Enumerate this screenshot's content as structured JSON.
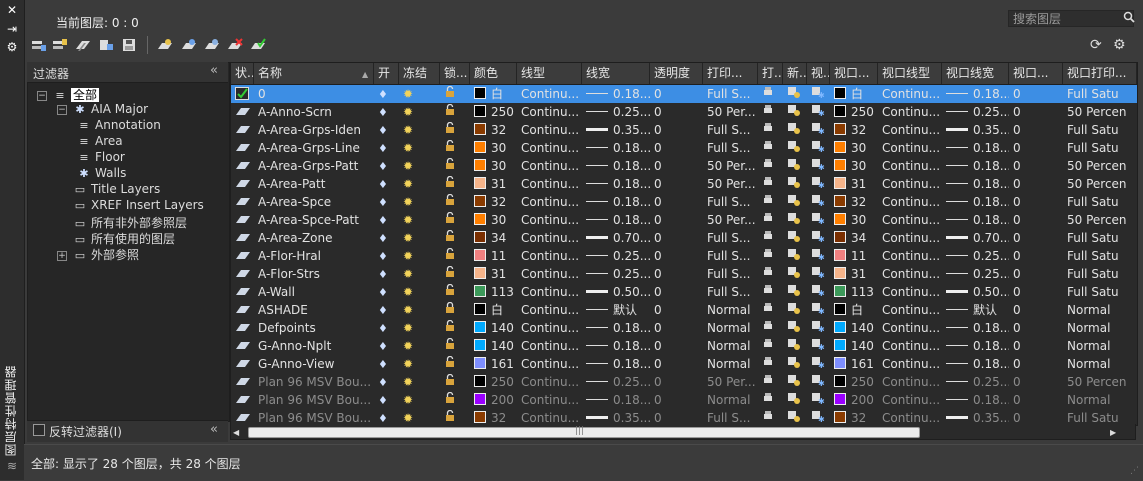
{
  "window": {
    "side_title": "图层特性管理器",
    "close_glyph": "✕",
    "pin_glyph": "⇥",
    "prop_glyph": "⚙"
  },
  "toolbar": {
    "current_layer": "当前图层: 0 : 0",
    "search_placeholder": "搜索图层",
    "buttons": [
      "new-property-filter-icon",
      "new-group-filter-icon",
      "layer-states-manager-icon",
      "properties-icon",
      "save-icon",
      "new-layer-icon",
      "new-layer-vp-frozen-icon",
      "new-layer-vp-all-icon",
      "delete-layer-icon",
      "set-current-icon"
    ],
    "refresh_glyph": "⟳",
    "settings_glyph": "⚙"
  },
  "filter_panel": {
    "title": "过滤器",
    "collapse_glyph": "«",
    "tree": [
      {
        "label": "全部",
        "expander": "−",
        "icon": "layers-icon",
        "level": 0
      },
      {
        "label": "AIA Major",
        "expander": "−",
        "icon": "group-filter-icon",
        "level": 1
      },
      {
        "label": "Annotation",
        "expander": "",
        "icon": "property-filter-icon",
        "level": 2
      },
      {
        "label": "Area",
        "expander": "",
        "icon": "property-filter-icon",
        "level": 2
      },
      {
        "label": "Floor",
        "expander": "",
        "icon": "property-filter-icon",
        "level": 2
      },
      {
        "label": "Walls",
        "expander": "",
        "icon": "group-filter-icon",
        "level": 2
      },
      {
        "label": "Title Layers",
        "expander": "",
        "icon": "xref-filter-icon",
        "level": 1
      },
      {
        "label": "XREF Insert Layers",
        "expander": "",
        "icon": "xref-filter-icon",
        "level": 1
      },
      {
        "label": "所有非外部参照层",
        "expander": "",
        "icon": "xref-filter-icon",
        "level": 1
      },
      {
        "label": "所有使用的图层",
        "expander": "",
        "icon": "xref-filter-icon",
        "level": 1
      },
      {
        "label": "外部参照",
        "expander": "+",
        "icon": "xref-folder-icon",
        "level": 1
      }
    ],
    "invert_label": "反转过滤器(I)"
  },
  "grid": {
    "columns": [
      "状...",
      "名称",
      "开",
      "冻结",
      "锁...",
      "颜色",
      "线型",
      "线宽",
      "透明度",
      "打印...",
      "打...",
      "新...",
      "视...",
      "视口...",
      "视口线型",
      "视口线宽",
      "视口...",
      "视口打印..."
    ],
    "rows": [
      {
        "name": "0",
        "color": "#000000",
        "color_label": "白",
        "linetype": "Continu...",
        "lineweight": "0.18...",
        "lw_thick": false,
        "transparency": "0",
        "plot_style": "Full S...",
        "vp_color": "#000000",
        "vp_color_label": "白",
        "vp_linetype": "Continu...",
        "vp_lineweight": "0.18...",
        "vp_transparency": "0",
        "vp_plot_style": "Full Satu",
        "selected": true,
        "dim": false,
        "locked": false
      },
      {
        "name": "A-Anno-Scrn",
        "color": "#000000",
        "color_label": "250",
        "linetype": "Continu...",
        "lineweight": "0.25...",
        "lw_thick": false,
        "transparency": "0",
        "plot_style": "50 Per...",
        "vp_color": "#000000",
        "vp_color_label": "250",
        "vp_linetype": "Continu...",
        "vp_lineweight": "0.25...",
        "vp_transparency": "0",
        "vp_plot_style": "50 Percen",
        "selected": false,
        "dim": false,
        "locked": false
      },
      {
        "name": "A-Area-Grps-Iden",
        "color": "#8a3b00",
        "color_label": "32",
        "linetype": "Continu...",
        "lineweight": "0.35...",
        "lw_thick": true,
        "transparency": "0",
        "plot_style": "Full S...",
        "vp_color": "#8a3b00",
        "vp_color_label": "32",
        "vp_linetype": "Continu...",
        "vp_lineweight": "0.35...",
        "vp_transparency": "0",
        "vp_plot_style": "Full Satu",
        "selected": false,
        "dim": false,
        "locked": false
      },
      {
        "name": "A-Area-Grps-Line",
        "color": "#ff7f00",
        "color_label": "30",
        "linetype": "Continu...",
        "lineweight": "0.18...",
        "lw_thick": false,
        "transparency": "0",
        "plot_style": "Full S...",
        "vp_color": "#ff7f00",
        "vp_color_label": "30",
        "vp_linetype": "Continu...",
        "vp_lineweight": "0.18...",
        "vp_transparency": "0",
        "vp_plot_style": "Full Satu",
        "selected": false,
        "dim": false,
        "locked": false
      },
      {
        "name": "A-Area-Grps-Patt",
        "color": "#ff7f00",
        "color_label": "30",
        "linetype": "Continu...",
        "lineweight": "0.18...",
        "lw_thick": false,
        "transparency": "0",
        "plot_style": "50 Per...",
        "vp_color": "#ff7f00",
        "vp_color_label": "30",
        "vp_linetype": "Continu...",
        "vp_lineweight": "0.18...",
        "vp_transparency": "0",
        "vp_plot_style": "50 Percen",
        "selected": false,
        "dim": false,
        "locked": false
      },
      {
        "name": "A-Area-Patt",
        "color": "#f5b48a",
        "color_label": "31",
        "linetype": "Continu...",
        "lineweight": "0.18...",
        "lw_thick": false,
        "transparency": "0",
        "plot_style": "50 Per...",
        "vp_color": "#f5b48a",
        "vp_color_label": "31",
        "vp_linetype": "Continu...",
        "vp_lineweight": "0.18...",
        "vp_transparency": "0",
        "vp_plot_style": "50 Percen",
        "selected": false,
        "dim": false,
        "locked": false
      },
      {
        "name": "A-Area-Spce",
        "color": "#8a3b00",
        "color_label": "32",
        "linetype": "Continu...",
        "lineweight": "0.18...",
        "lw_thick": false,
        "transparency": "0",
        "plot_style": "Full S...",
        "vp_color": "#8a3b00",
        "vp_color_label": "32",
        "vp_linetype": "Continu...",
        "vp_lineweight": "0.18...",
        "vp_transparency": "0",
        "vp_plot_style": "Full Satu",
        "selected": false,
        "dim": false,
        "locked": false
      },
      {
        "name": "A-Area-Spce-Patt",
        "color": "#ff7f00",
        "color_label": "30",
        "linetype": "Continu...",
        "lineweight": "0.18...",
        "lw_thick": false,
        "transparency": "0",
        "plot_style": "50 Per...",
        "vp_color": "#ff7f00",
        "vp_color_label": "30",
        "vp_linetype": "Continu...",
        "vp_lineweight": "0.18...",
        "vp_transparency": "0",
        "vp_plot_style": "50 Percen",
        "selected": false,
        "dim": false,
        "locked": false
      },
      {
        "name": "A-Area-Zone",
        "color": "#7a2e00",
        "color_label": "34",
        "linetype": "Continu...",
        "lineweight": "0.70...",
        "lw_thick": true,
        "transparency": "0",
        "plot_style": "Full S...",
        "vp_color": "#7a2e00",
        "vp_color_label": "34",
        "vp_linetype": "Continu...",
        "vp_lineweight": "0.70...",
        "vp_transparency": "0",
        "vp_plot_style": "Full Satu",
        "selected": false,
        "dim": false,
        "locked": false
      },
      {
        "name": "A-Flor-Hral",
        "color": "#f08080",
        "color_label": "11",
        "linetype": "Continu...",
        "lineweight": "0.25...",
        "lw_thick": false,
        "transparency": "0",
        "plot_style": "Full S...",
        "vp_color": "#f08080",
        "vp_color_label": "11",
        "vp_linetype": "Continu...",
        "vp_lineweight": "0.25...",
        "vp_transparency": "0",
        "vp_plot_style": "Full Satu",
        "selected": false,
        "dim": false,
        "locked": false
      },
      {
        "name": "A-Flor-Strs",
        "color": "#f5b48a",
        "color_label": "31",
        "linetype": "Continu...",
        "lineweight": "0.25...",
        "lw_thick": false,
        "transparency": "0",
        "plot_style": "Full S...",
        "vp_color": "#f5b48a",
        "vp_color_label": "31",
        "vp_linetype": "Continu...",
        "vp_lineweight": "0.25...",
        "vp_transparency": "0",
        "vp_plot_style": "Full Satu",
        "selected": false,
        "dim": false,
        "locked": false
      },
      {
        "name": "A-Wall",
        "color": "#3c9a5a",
        "color_label": "113",
        "linetype": "Continu...",
        "lineweight": "0.50...",
        "lw_thick": true,
        "transparency": "0",
        "plot_style": "Full S...",
        "vp_color": "#3c9a5a",
        "vp_color_label": "113",
        "vp_linetype": "Continu...",
        "vp_lineweight": "0.50...",
        "vp_transparency": "0",
        "vp_plot_style": "Full Satu",
        "selected": false,
        "dim": false,
        "locked": false
      },
      {
        "name": "ASHADE",
        "color": "#000000",
        "color_label": "白",
        "linetype": "Continu...",
        "lineweight": "默认",
        "lw_thick": false,
        "transparency": "0",
        "plot_style": "Normal",
        "vp_color": "#000000",
        "vp_color_label": "白",
        "vp_linetype": "Continu...",
        "vp_lineweight": "默认",
        "vp_transparency": "0",
        "vp_plot_style": "Normal",
        "selected": false,
        "dim": false,
        "locked": true
      },
      {
        "name": "Defpoints",
        "color": "#00aaff",
        "color_label": "140",
        "linetype": "Continu...",
        "lineweight": "0.18...",
        "lw_thick": false,
        "transparency": "0",
        "plot_style": "Normal",
        "vp_color": "#00aaff",
        "vp_color_label": "140",
        "vp_linetype": "Continu...",
        "vp_lineweight": "0.18...",
        "vp_transparency": "0",
        "vp_plot_style": "Normal",
        "selected": false,
        "dim": false,
        "locked": false
      },
      {
        "name": "G-Anno-Nplt",
        "color": "#00aaff",
        "color_label": "140",
        "linetype": "Continu...",
        "lineweight": "0.18...",
        "lw_thick": false,
        "transparency": "0",
        "plot_style": "Normal",
        "vp_color": "#00aaff",
        "vp_color_label": "140",
        "vp_linetype": "Continu...",
        "vp_lineweight": "0.18...",
        "vp_transparency": "0",
        "vp_plot_style": "Normal",
        "selected": false,
        "dim": false,
        "locked": false
      },
      {
        "name": "G-Anno-View",
        "color": "#7f8fff",
        "color_label": "161",
        "linetype": "Continu...",
        "lineweight": "0.18...",
        "lw_thick": false,
        "transparency": "0",
        "plot_style": "Normal",
        "vp_color": "#7f8fff",
        "vp_color_label": "161",
        "vp_linetype": "Continu...",
        "vp_lineweight": "0.18...",
        "vp_transparency": "0",
        "vp_plot_style": "Normal",
        "selected": false,
        "dim": false,
        "locked": false
      },
      {
        "name": "Plan 96 MSV Bou...",
        "color": "#000000",
        "color_label": "250",
        "linetype": "Continu...",
        "lineweight": "0.25...",
        "lw_thick": false,
        "transparency": "0",
        "plot_style": "50 Per...",
        "vp_color": "#000000",
        "vp_color_label": "250",
        "vp_linetype": "Continu...",
        "vp_lineweight": "0.25...",
        "vp_transparency": "0",
        "vp_plot_style": "50 Percen",
        "selected": false,
        "dim": true,
        "locked": false
      },
      {
        "name": "Plan 96 MSV Bou...",
        "color": "#9b00ff",
        "color_label": "200",
        "linetype": "Continu...",
        "lineweight": "0.18...",
        "lw_thick": false,
        "transparency": "0",
        "plot_style": "Normal",
        "vp_color": "#9b00ff",
        "vp_color_label": "200",
        "vp_linetype": "Continu...",
        "vp_lineweight": "0.18...",
        "vp_transparency": "0",
        "vp_plot_style": "Normal",
        "selected": false,
        "dim": true,
        "locked": false
      },
      {
        "name": "Plan 96 MSV Bou...",
        "color": "#8a3b00",
        "color_label": "32",
        "linetype": "Continu...",
        "lineweight": "0.35...",
        "lw_thick": true,
        "transparency": "0",
        "plot_style": "Full S...",
        "vp_color": "#8a3b00",
        "vp_color_label": "32",
        "vp_linetype": "Continu...",
        "vp_lineweight": "0.35...",
        "vp_transparency": "0",
        "vp_plot_style": "Full Satu",
        "selected": false,
        "dim": true,
        "locked": false
      }
    ]
  },
  "scrollbar": {
    "left_glyph": "◀",
    "right_glyph": "▶",
    "grip_glyph": "|||"
  },
  "status": {
    "text": "全部: 显示了 28 个图层，共 28 个图层"
  }
}
